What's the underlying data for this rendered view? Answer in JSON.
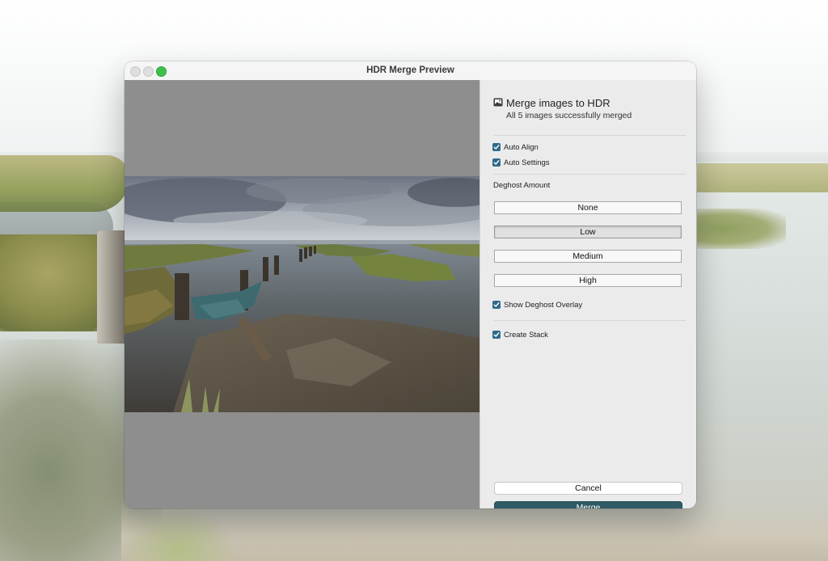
{
  "window": {
    "title": "HDR Merge Preview"
  },
  "panel": {
    "heading": "Merge images to HDR",
    "subheading": "All 5 images successfully merged",
    "auto_align": {
      "label": "Auto Align",
      "checked": true
    },
    "auto_settings": {
      "label": "Auto Settings",
      "checked": true
    },
    "deghost": {
      "label": "Deghost Amount",
      "options": [
        "None",
        "Low",
        "Medium",
        "High"
      ],
      "selected": "Low"
    },
    "show_deghost_overlay": {
      "label": "Show Deghost Overlay",
      "checked": true
    },
    "create_stack": {
      "label": "Create Stack",
      "checked": true
    },
    "cancel_label": "Cancel",
    "merge_label": "Merge"
  },
  "colors": {
    "checkbox": "#2f6a8a",
    "merge_button": "#2f5a66",
    "zoom_button": "#3ebf4b",
    "preview_background": "#8e8e8e"
  },
  "icons": [
    "photo-icon",
    "checkmark-icon"
  ]
}
